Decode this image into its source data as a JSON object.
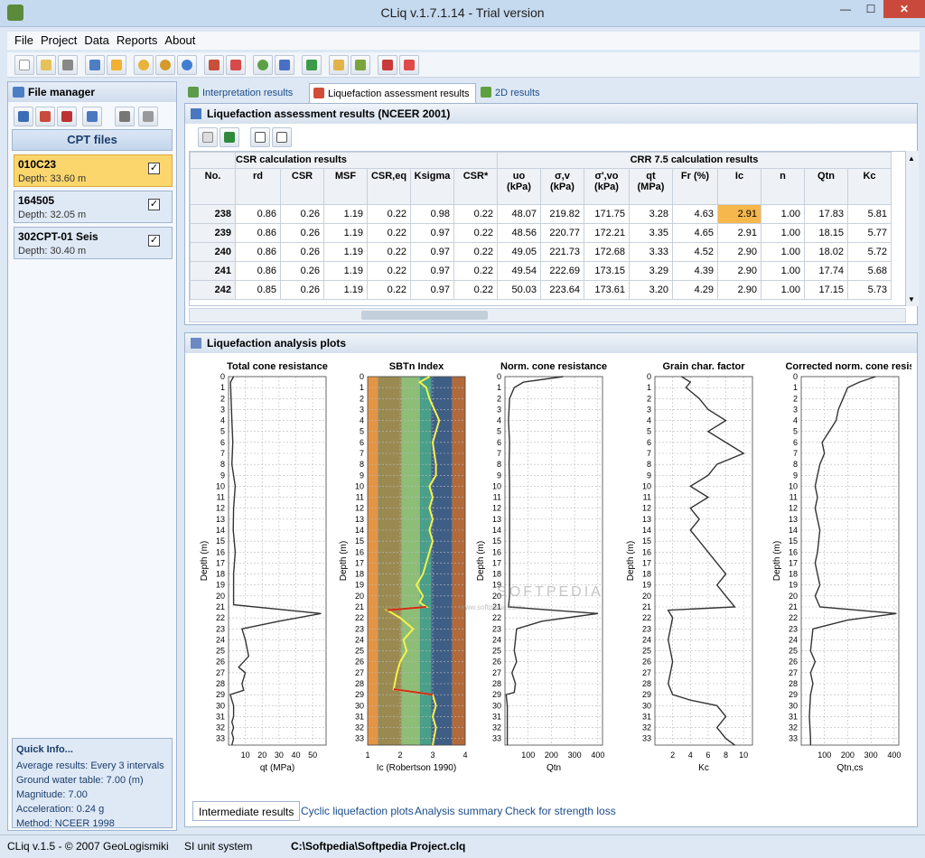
{
  "window": {
    "title": "CLiq v.1.7.1.14 - Trial version",
    "minimize": "—",
    "maximize": "☐",
    "close": "✕"
  },
  "menu": [
    "File",
    "Project",
    "Data",
    "Reports",
    "About"
  ],
  "file_manager": {
    "title": "File manager",
    "cpt_header": "CPT files",
    "files": [
      {
        "name": "010C23",
        "depth": "Depth: 33.60 m",
        "checked": true,
        "selected": true
      },
      {
        "name": "164505",
        "depth": "Depth: 32.05 m",
        "checked": true,
        "selected": false
      },
      {
        "name": "302CPT-01 Seis",
        "depth": "Depth: 30.40 m",
        "checked": true,
        "selected": false
      }
    ]
  },
  "quick_info": {
    "title": "Quick Info...",
    "lines": [
      "Average results: Every 3 intervals",
      "Ground water table: 7.00 (m)",
      "Magnitude: 7.00",
      "Acceleration: 0.24 g",
      "Method: NCEER 1998"
    ]
  },
  "tabs": [
    "Interpretation results",
    "Liquefaction assessment results",
    "2D results"
  ],
  "results": {
    "title": "Liquefaction assessment results (NCEER 2001)",
    "group_csr": "CSR calculation results",
    "group_crr": "CRR 7.5 calculation results",
    "headers": [
      {
        "l1": "No.",
        "l2": ""
      },
      {
        "l1": "rd",
        "l2": ""
      },
      {
        "l1": "CSR",
        "l2": ""
      },
      {
        "l1": "MSF",
        "l2": ""
      },
      {
        "l1": "CSR,eq",
        "l2": ""
      },
      {
        "l1": "Ksigma",
        "l2": ""
      },
      {
        "l1": "CSR*",
        "l2": ""
      },
      {
        "l1": "uo",
        "l2": "(kPa)"
      },
      {
        "l1": "σ,v",
        "l2": "(kPa)"
      },
      {
        "l1": "σ',vo",
        "l2": "(kPa)"
      },
      {
        "l1": "qt",
        "l2": "(MPa)"
      },
      {
        "l1": "Fr (%)",
        "l2": ""
      },
      {
        "l1": "Ic",
        "l2": ""
      },
      {
        "l1": "n",
        "l2": ""
      },
      {
        "l1": "Qtn",
        "l2": ""
      },
      {
        "l1": "Kc",
        "l2": ""
      }
    ],
    "rows": [
      [
        "238",
        "0.86",
        "0.26",
        "1.19",
        "0.22",
        "0.98",
        "0.22",
        "48.07",
        "219.82",
        "171.75",
        "3.28",
        "4.63",
        "2.91",
        "1.00",
        "17.83",
        "5.81"
      ],
      [
        "239",
        "0.86",
        "0.26",
        "1.19",
        "0.22",
        "0.97",
        "0.22",
        "48.56",
        "220.77",
        "172.21",
        "3.35",
        "4.65",
        "2.91",
        "1.00",
        "18.15",
        "5.77"
      ],
      [
        "240",
        "0.86",
        "0.26",
        "1.19",
        "0.22",
        "0.97",
        "0.22",
        "49.05",
        "221.73",
        "172.68",
        "3.33",
        "4.52",
        "2.90",
        "1.00",
        "18.02",
        "5.72"
      ],
      [
        "241",
        "0.86",
        "0.26",
        "1.19",
        "0.22",
        "0.97",
        "0.22",
        "49.54",
        "222.69",
        "173.15",
        "3.29",
        "4.39",
        "2.90",
        "1.00",
        "17.74",
        "5.68"
      ],
      [
        "242",
        "0.85",
        "0.26",
        "1.19",
        "0.22",
        "0.97",
        "0.22",
        "50.03",
        "223.64",
        "173.61",
        "3.20",
        "4.29",
        "2.90",
        "1.00",
        "17.15",
        "5.73"
      ]
    ]
  },
  "plots": {
    "title": "Liquefaction analysis plots",
    "watermark": "SOFTPEDIA",
    "watermark_url": "www.softpedia.com",
    "ylabel": "Depth (m)",
    "depth_ticks": [
      "0",
      "1",
      "2",
      "3",
      "4",
      "5",
      "6",
      "7",
      "8",
      "9",
      "10",
      "11",
      "12",
      "13",
      "14",
      "15",
      "16",
      "17",
      "18",
      "19",
      "20",
      "21",
      "22",
      "23",
      "24",
      "25",
      "26",
      "27",
      "28",
      "29",
      "30",
      "31",
      "32",
      "33"
    ],
    "panels": [
      {
        "title": "Total cone resistance",
        "xlabel": "qt (MPa)",
        "xticks": [
          "10",
          "20",
          "30",
          "40",
          "50"
        ]
      },
      {
        "title": "SBTn Index",
        "xlabel": "Ic (Robertson 1990)",
        "xticks": [
          "1",
          "2",
          "3",
          "4"
        ]
      },
      {
        "title": "Norm. cone resistance",
        "xlabel": "Qtn",
        "xticks": [
          "100",
          "200",
          "300",
          "400"
        ]
      },
      {
        "title": "Grain char. factor",
        "xlabel": "Kc",
        "xticks": [
          "2",
          "4",
          "6",
          "8",
          "10"
        ]
      },
      {
        "title": "Corrected norm. cone resis",
        "xlabel": "Qtn,cs",
        "xticks": [
          "100",
          "200",
          "300",
          "400"
        ]
      }
    ]
  },
  "chart_data": [
    {
      "type": "line",
      "title": "Total cone resistance",
      "xlabel": "qt (MPa)",
      "ylabel": "Depth (m)",
      "xlim": [
        0,
        58
      ],
      "ylim": [
        33.6,
        0
      ],
      "series": [
        {
          "x": [
            3,
            1.2,
            1.5,
            2,
            2.5,
            2,
            4,
            3,
            2.8,
            4,
            3,
            3,
            55,
            30,
            8,
            10,
            12,
            6,
            10,
            8,
            9,
            1,
            2,
            3,
            3,
            2,
            3,
            2,
            3,
            2
          ],
          "y": [
            0,
            0.5,
            2,
            4,
            6,
            8,
            10,
            12,
            14,
            16,
            18,
            20.8,
            21.6,
            22.3,
            23,
            24,
            25.5,
            26.5,
            27,
            28,
            28.6,
            29,
            29.5,
            30,
            31,
            31.5,
            32,
            32.5,
            33,
            33.6
          ]
        }
      ]
    },
    {
      "type": "line",
      "title": "SBTn Index",
      "xlabel": "Ic (Robertson 1990)",
      "ylabel": "Depth (m)",
      "xlim": [
        1,
        4
      ],
      "ylim": [
        33.6,
        0
      ],
      "series": [
        {
          "x": [
            2.9,
            2.6,
            2.8,
            2.9,
            3.2,
            3.0,
            3.1,
            3.1,
            2.9,
            3.0,
            2.9,
            3.0,
            2.9,
            3.0,
            2.9,
            2.8,
            2.7,
            2.5,
            2.7,
            2.6,
            2.8,
            1.6,
            2.0,
            2.4,
            2.1,
            2.2,
            2.0,
            1.9,
            1.8,
            3.0,
            3.1,
            3.0,
            3.1,
            3.0
          ],
          "y": [
            0,
            0.5,
            1,
            2,
            4,
            6,
            8,
            9,
            10,
            11,
            12,
            13,
            14,
            15,
            16,
            17,
            18,
            19,
            20,
            20.6,
            21,
            21.3,
            22,
            23,
            24,
            25,
            26,
            27,
            28.5,
            29,
            30,
            31,
            32,
            33.6
          ]
        }
      ]
    },
    {
      "type": "line",
      "title": "Norm. cone resistance",
      "xlabel": "Qtn",
      "ylabel": "Depth (m)",
      "xlim": [
        0,
        420
      ],
      "ylim": [
        33.6,
        0
      ],
      "series": [
        {
          "x": [
            250,
            80,
            40,
            20,
            15,
            20,
            18,
            20,
            20,
            20,
            20,
            15,
            400,
            160,
            50,
            40,
            50,
            30,
            45,
            40,
            5,
            10,
            10,
            10,
            10,
            10
          ],
          "y": [
            0,
            0.5,
            1,
            2,
            4,
            6,
            8,
            10,
            12,
            16,
            20,
            21,
            21.6,
            22.3,
            23,
            25,
            26,
            27,
            28,
            28.8,
            29,
            30,
            31,
            32,
            33,
            33.6
          ]
        }
      ]
    },
    {
      "type": "line",
      "title": "Grain char. factor",
      "xlabel": "Kc",
      "ylabel": "Depth (m)",
      "xlim": [
        0,
        11
      ],
      "ylim": [
        33.6,
        0
      ],
      "series": [
        {
          "x": [
            3,
            4,
            3.5,
            5,
            6,
            8,
            6,
            8,
            10,
            7,
            6,
            4,
            6,
            4,
            5,
            4,
            5,
            6,
            7,
            8,
            7,
            8,
            9,
            1.5,
            2,
            1.5,
            2,
            1.5,
            2,
            4,
            7,
            8,
            7,
            8,
            9
          ],
          "y": [
            0,
            0.5,
            1,
            2,
            3,
            4,
            5,
            6,
            7,
            8,
            9,
            10,
            11,
            12,
            13,
            14,
            15,
            16,
            17,
            18,
            19,
            20,
            21,
            21.3,
            22,
            24,
            26,
            28,
            29,
            29.5,
            30,
            31,
            32,
            33,
            33.6
          ]
        }
      ]
    },
    {
      "type": "line",
      "title": "Corrected norm. cone resis",
      "xlabel": "Qtn,cs",
      "ylabel": "Depth (m)",
      "xlim": [
        0,
        420
      ],
      "ylim": [
        33.6,
        0
      ],
      "series": [
        {
          "x": [
            320,
            250,
            200,
            180,
            160,
            150,
            120,
            90,
            100,
            80,
            60,
            70,
            60,
            80,
            70,
            60,
            70,
            80,
            60,
            70,
            80,
            410,
            200,
            50,
            40,
            60,
            40,
            50,
            40,
            35,
            40,
            40
          ],
          "y": [
            0,
            0.5,
            1,
            2,
            3,
            4,
            5,
            6,
            7,
            8,
            10,
            11,
            12,
            14,
            16,
            17,
            18,
            19,
            20,
            20.5,
            21,
            21.6,
            22.2,
            23,
            25,
            26,
            27,
            28,
            29,
            31,
            33,
            33.6
          ]
        }
      ]
    }
  ],
  "bottom_tabs": [
    "Intermediate results",
    "Cyclic liquefaction plots",
    "Analysis summary",
    "Check for strength loss"
  ],
  "status": {
    "version": "CLiq v.1.5 - © 2007 GeoLogismiki",
    "units": "SI unit system",
    "path": "C:\\Softpedia\\Softpedia Project.clq"
  },
  "colors": {
    "accent": "#fbd66d",
    "highlight_cell": "#f6b74d",
    "sbt_bands": [
      "#e39545",
      "#9a8a52",
      "#8ebd78",
      "#4a9f8a",
      "#3f5e86",
      "#b36a3a"
    ],
    "ic_line": "#f5f24a",
    "ic_red": "#d22a1a"
  }
}
